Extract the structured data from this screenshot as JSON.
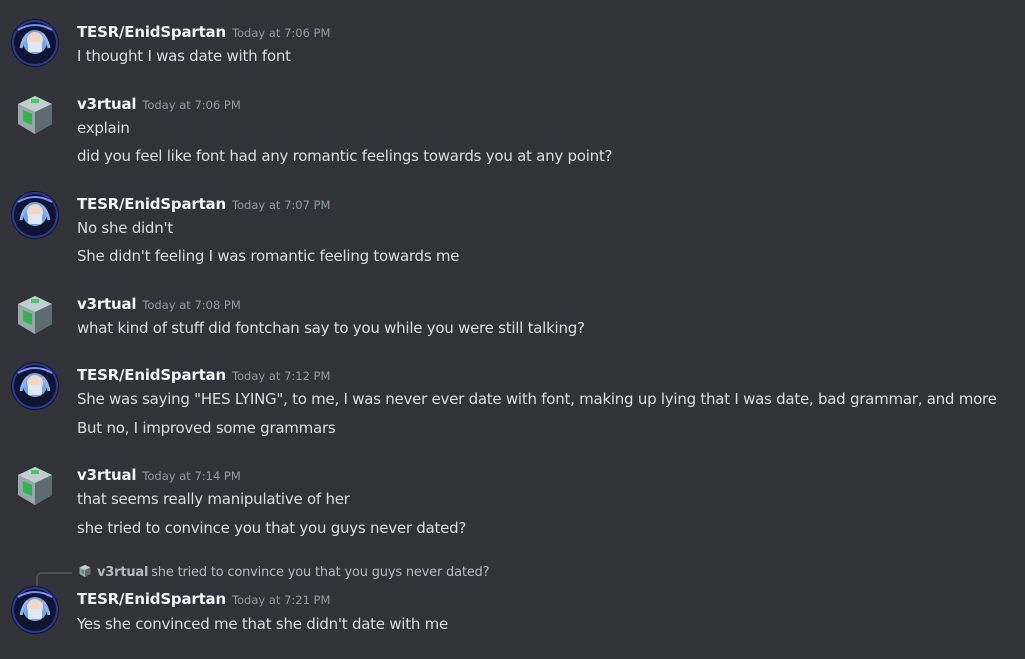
{
  "users": {
    "enid": {
      "name": "TESR/EnidSpartan",
      "avatar_icon": "anime-girl-avatar-icon"
    },
    "v3rtual": {
      "name": "v3rtual",
      "avatar_icon": "computer-cube-avatar-icon"
    }
  },
  "messages": [
    {
      "author": "TESR/EnidSpartan",
      "timestamp": "Today at 7:06 PM",
      "lines": [
        "I thought I was date with font"
      ]
    },
    {
      "author": "v3rtual",
      "timestamp": "Today at 7:06 PM",
      "lines": [
        "explain",
        "did you feel like font had any romantic feelings towards you at any point?"
      ]
    },
    {
      "author": "TESR/EnidSpartan",
      "timestamp": "Today at 7:07 PM",
      "lines": [
        "No she didn't",
        "She didn't feeling I was romantic feeling towards me"
      ]
    },
    {
      "author": "v3rtual",
      "timestamp": "Today at 7:08 PM",
      "lines": [
        "what kind of stuff did fontchan say to you while you were still talking?"
      ]
    },
    {
      "author": "TESR/EnidSpartan",
      "timestamp": "Today at 7:12 PM",
      "lines": [
        "She was saying \"HES  LYING\", to me, I was never ever date with font, making up lying that I was date, bad grammar, and more",
        "But no, I improved some grammars"
      ]
    },
    {
      "author": "v3rtual",
      "timestamp": "Today at 7:14 PM",
      "lines": [
        "that seems really manipulative of her",
        "she tried to convince you that you guys never dated?"
      ]
    },
    {
      "author": "TESR/EnidSpartan",
      "timestamp": "Today at 7:21 PM",
      "lines": [
        "Yes she convinced me that she didn't date with me"
      ],
      "reply_to": {
        "author": "v3rtual",
        "text": "she tried to convince you that you guys never dated?"
      }
    }
  ],
  "colors": {
    "background": "#313338",
    "username": "#f2f3f5",
    "text": "#dbdee1",
    "timestamp": "#949ba4"
  }
}
